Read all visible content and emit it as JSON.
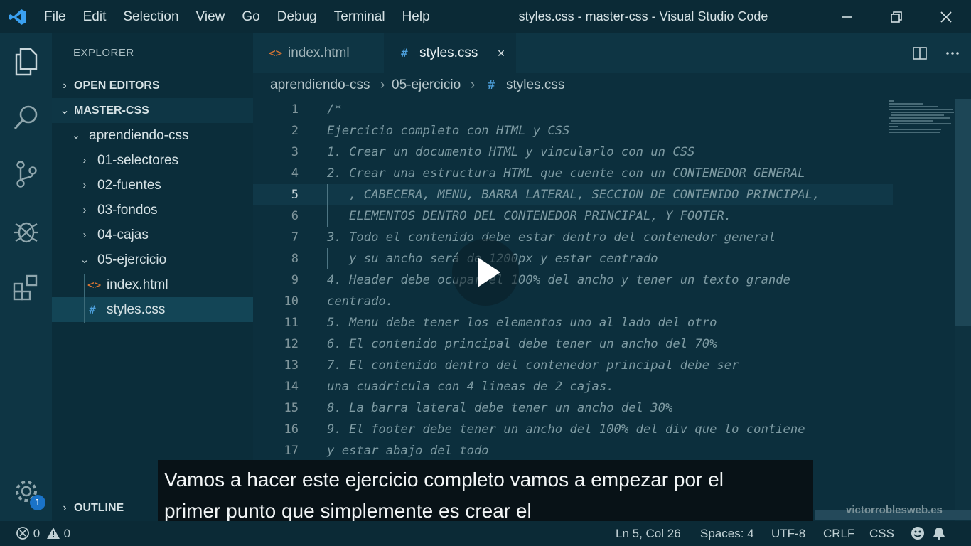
{
  "window": {
    "title": "styles.css - master-css - Visual Studio Code",
    "menu": [
      "File",
      "Edit",
      "Selection",
      "View",
      "Go",
      "Debug",
      "Terminal",
      "Help"
    ]
  },
  "sidebar": {
    "header": "EXPLORER",
    "open_editors": "OPEN EDITORS",
    "workspace": "MASTER-CSS",
    "tree": [
      {
        "label": "aprendiendo-css",
        "chevron": "⌄"
      },
      {
        "label": "01-selectores",
        "chevron": "›"
      },
      {
        "label": "02-fuentes",
        "chevron": "›"
      },
      {
        "label": "03-fondos",
        "chevron": "›"
      },
      {
        "label": "04-cajas",
        "chevron": "›"
      },
      {
        "label": "05-ejercicio",
        "chevron": "⌄"
      },
      {
        "label": "index.html",
        "icon": "<>"
      },
      {
        "label": "styles.css",
        "icon": "#"
      }
    ],
    "outline": "OUTLINE"
  },
  "tabs": [
    {
      "label": "index.html",
      "icon": "<>"
    },
    {
      "label": "styles.css",
      "icon": "#",
      "close": "×"
    }
  ],
  "breadcrumb": [
    "aprendiendo-css",
    "05-ejercicio",
    "styles.css"
  ],
  "breadcrumb_icon": "#",
  "breadcrumb_sep": "›",
  "editor": {
    "lines": [
      {
        "n": "1",
        "text": "/*"
      },
      {
        "n": "2",
        "text": "Ejercicio completo con HTML y CSS"
      },
      {
        "n": "3",
        "text": "1. Crear un documento HTML y vincularlo con un CSS"
      },
      {
        "n": "4",
        "text": "2. Crear una estructura HTML que cuente con un CONTENEDOR GENERAL"
      },
      {
        "n": "5",
        "text": "   , CABECERA, MENU, BARRA LATERAL, SECCION DE CONTENIDO PRINCIPAL,"
      },
      {
        "n": "6",
        "text": "   ELEMENTOS DENTRO DEL CONTENEDOR PRINCIPAL, Y FOOTER."
      },
      {
        "n": "7",
        "text": "3. Todo el contenido debe estar dentro del contenedor general"
      },
      {
        "n": "8",
        "text": "   y su ancho será de 1200px y estar centrado"
      },
      {
        "n": "9",
        "text": "4. Header debe ocupar el 100% del ancho y tener un texto grande"
      },
      {
        "n": "10",
        "text": "centrado."
      },
      {
        "n": "11",
        "text": "5. Menu debe tener los elementos uno al lado del otro"
      },
      {
        "n": "12",
        "text": "6. El contenido principal debe tener un ancho del 70%"
      },
      {
        "n": "13",
        "text": "7. El contenido dentro del contenedor principal debe ser"
      },
      {
        "n": "14",
        "text": "una cuadricula con 4 lineas de 2 cajas."
      },
      {
        "n": "15",
        "text": "8. La barra lateral debe tener un ancho del 30%"
      },
      {
        "n": "16",
        "text": "9. El footer debe tener un ancho del 100% del div que lo contiene"
      },
      {
        "n": "17",
        "text": "y estar abajo del todo"
      }
    ]
  },
  "subtitle": [
    "Vamos a hacer este ejercicio completo vamos a empezar por el",
    "primer punto que simplemente es crear el"
  ],
  "watermark": "victorroblesweb.es",
  "activity": {
    "badge": "1"
  },
  "status": {
    "errors": "0",
    "warnings": "0",
    "position": "Ln 5, Col 26",
    "spaces": "Spaces: 4",
    "encoding": "UTF-8",
    "eol": "CRLF",
    "language": "CSS"
  },
  "colors": {
    "background": "#0c2f3d",
    "sidebar": "#0b2d3a",
    "accent": "#1a73c8",
    "vscode_logo": "#3aa0f0"
  },
  "icons": [
    "vscode-logo-icon",
    "minimize-icon",
    "restore-icon",
    "close-icon",
    "files-icon",
    "search-icon",
    "source-control-icon",
    "debug-icon",
    "extensions-icon",
    "settings-gear-icon",
    "split-editor-icon",
    "more-actions-icon",
    "play-icon",
    "error-icon",
    "warning-icon",
    "feedback-icon",
    "bell-icon"
  ]
}
